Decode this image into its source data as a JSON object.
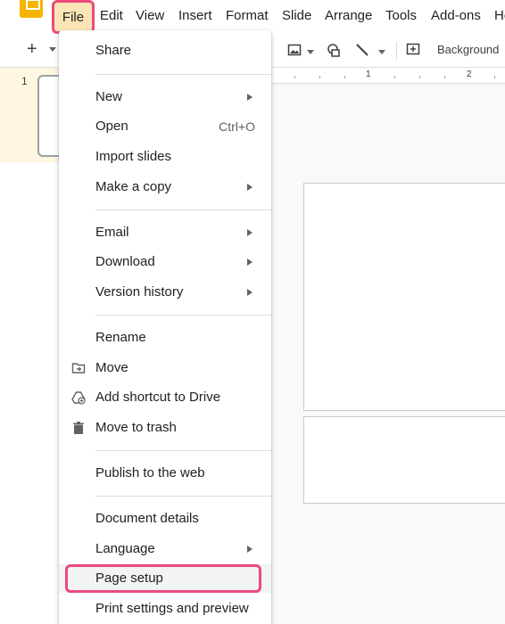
{
  "menubar": {
    "items": [
      {
        "label": "File"
      },
      {
        "label": "Edit"
      },
      {
        "label": "View"
      },
      {
        "label": "Insert"
      },
      {
        "label": "Format"
      },
      {
        "label": "Slide"
      },
      {
        "label": "Arrange"
      },
      {
        "label": "Tools"
      },
      {
        "label": "Add-ons"
      },
      {
        "label": "He"
      }
    ]
  },
  "toolbar": {
    "background_label": "Background"
  },
  "ruler": {
    "marks": [
      "1",
      "2"
    ]
  },
  "filmstrip": {
    "slide_number": "1"
  },
  "file_menu": {
    "items": [
      {
        "label": "Share",
        "icon": "",
        "submenu": false
      },
      {
        "label": "New",
        "icon": "",
        "submenu": true
      },
      {
        "label": "Open",
        "icon": "",
        "shortcut": "Ctrl+O",
        "submenu": false
      },
      {
        "label": "Import slides",
        "icon": "",
        "submenu": false
      },
      {
        "label": "Make a copy",
        "icon": "",
        "submenu": true
      },
      {
        "label": "Email",
        "icon": "",
        "submenu": true
      },
      {
        "label": "Download",
        "icon": "",
        "submenu": true
      },
      {
        "label": "Version history",
        "icon": "",
        "submenu": true
      },
      {
        "label": "Rename",
        "icon": "",
        "submenu": false
      },
      {
        "label": "Move",
        "icon": "folder-move-icon",
        "submenu": false
      },
      {
        "label": "Add shortcut to Drive",
        "icon": "drive-shortcut-icon",
        "submenu": false
      },
      {
        "label": "Move to trash",
        "icon": "trash-icon",
        "submenu": false
      },
      {
        "label": "Publish to the web",
        "icon": "",
        "submenu": false
      },
      {
        "label": "Document details",
        "icon": "",
        "submenu": false
      },
      {
        "label": "Language",
        "icon": "",
        "submenu": true
      },
      {
        "label": "Page setup",
        "icon": "",
        "submenu": false,
        "highlighted": true
      },
      {
        "label": "Print settings and preview",
        "icon": "",
        "submenu": false
      }
    ]
  },
  "colors": {
    "highlight_border": "#ec4a7b",
    "file_active_bg": "#fbe5b6",
    "app_logo": "#f4b400"
  }
}
